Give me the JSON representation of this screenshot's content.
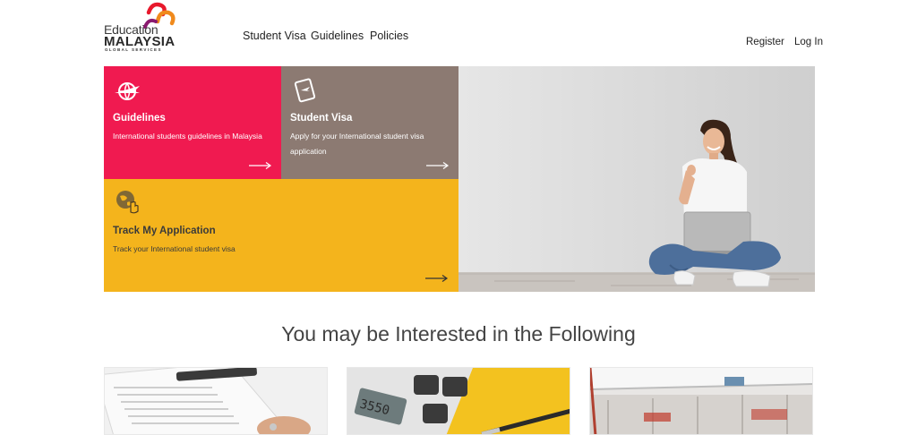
{
  "header": {
    "logo": {
      "line1": "Education",
      "line2": "MALAYSIA",
      "line3": "GLOBAL SERVICES"
    },
    "nav": [
      {
        "label": "Student Visa"
      },
      {
        "label": "Guidelines"
      },
      {
        "label": "Policies"
      }
    ],
    "register_label": "Register",
    "login_label": "Log In"
  },
  "hero": {
    "tiles": [
      {
        "title": "Guidelines",
        "description": "International students guidelines in Malaysia",
        "color": "#f01a50",
        "icon": "globe-plane-icon"
      },
      {
        "title": "Student Visa",
        "description": "Apply for your International student visa application",
        "color": "#8c7a72",
        "icon": "passport-icon"
      },
      {
        "title": "Track My Application",
        "description": "Track your International student visa",
        "color": "#f4b41c",
        "icon": "globe-hand-icon"
      }
    ],
    "image": "student-with-laptop-photo"
  },
  "section": {
    "title": "You may be Interested in the Following"
  },
  "cards": [
    {
      "image": "documents-pen-photo"
    },
    {
      "image": "calculator-pen-photo"
    },
    {
      "image": "building-interior-photo"
    }
  ]
}
